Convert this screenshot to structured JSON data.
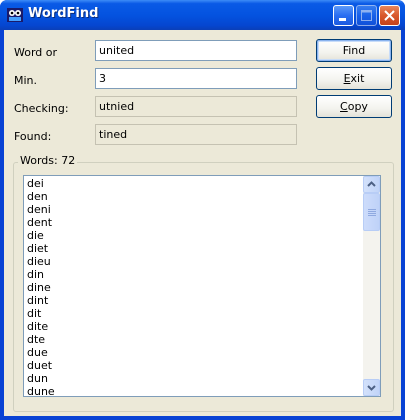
{
  "window": {
    "title": "WordFind"
  },
  "form": {
    "word_label": "Word or",
    "word_value": "united",
    "min_label": "Min.",
    "min_value": "3",
    "checking_label": "Checking:",
    "checking_value": "utnied",
    "found_label": "Found:",
    "found_value": "tined"
  },
  "buttons": {
    "find": "Find",
    "exit_prefix": "",
    "exit_mnemonic": "E",
    "exit_rest": "xit",
    "copy_prefix": "",
    "copy_mnemonic": "C",
    "copy_rest": "opy"
  },
  "words_group": {
    "title": "Words: 72",
    "items": [
      "dei",
      "den",
      "deni",
      "dent",
      "die",
      "diet",
      "dieu",
      "din",
      "dine",
      "dint",
      "dit",
      "dite",
      "dte",
      "due",
      "duet",
      "dun",
      "dune"
    ]
  },
  "colors": {
    "titlebar": "#0453e0",
    "client": "#ece9d8",
    "close_button": "#d9582c"
  }
}
